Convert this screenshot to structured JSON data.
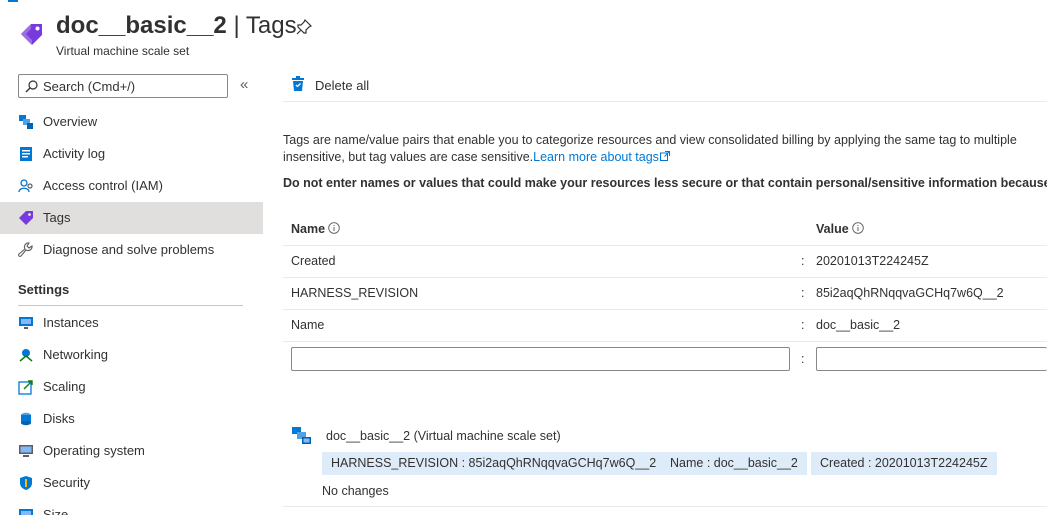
{
  "header": {
    "resource_name": "doc__basic__2",
    "separator": " | ",
    "blade_name": "Tags",
    "subtitle": "Virtual machine scale set",
    "icon": "tag-icon",
    "pin_icon": "pin-icon"
  },
  "sidebar": {
    "search_placeholder": "Search (Cmd+/)",
    "collapse_glyph": "«",
    "items": [
      {
        "label": "Overview",
        "icon": "overview-icon"
      },
      {
        "label": "Activity log",
        "icon": "activity-log-icon"
      },
      {
        "label": "Access control (IAM)",
        "icon": "iam-icon"
      },
      {
        "label": "Tags",
        "icon": "tag-icon",
        "active": true
      },
      {
        "label": "Diagnose and solve problems",
        "icon": "wrench-icon"
      }
    ],
    "settings_heading": "Settings",
    "settings_items": [
      {
        "label": "Instances",
        "icon": "instances-icon"
      },
      {
        "label": "Networking",
        "icon": "networking-icon"
      },
      {
        "label": "Scaling",
        "icon": "scaling-icon"
      },
      {
        "label": "Disks",
        "icon": "disks-icon"
      },
      {
        "label": "Operating system",
        "icon": "operating-system-icon"
      },
      {
        "label": "Security",
        "icon": "security-icon"
      },
      {
        "label": "Size",
        "icon": "size-icon"
      }
    ]
  },
  "toolbar": {
    "delete_all_label": "Delete all"
  },
  "main": {
    "description_line1": "Tags are name/value pairs that enable you to categorize resources and view consolidated billing by applying the same tag to multiple",
    "description_line2": "insensitive, but tag values are case sensitive.",
    "learn_more_link": "Learn more about tags",
    "warning": "Do not enter names or values that could make your resources less secure or that contain personal/sensitive information because t",
    "table": {
      "name_header": "Name",
      "value_header": "Value",
      "separator": ":",
      "rows": [
        {
          "name": "Created",
          "value": "20201013T224245Z"
        },
        {
          "name": "HARNESS_REVISION",
          "value": "85i2aqQhRNqqvaGCHq7w6Q__2"
        },
        {
          "name": "Name",
          "value": "doc__basic__2"
        }
      ],
      "new_name_value": "",
      "new_value_value": ""
    },
    "summary": {
      "resource_title": "doc__basic__2  (Virtual machine scale set)",
      "chips": [
        "HARNESS_REVISION : 85i2aqQhRNqqvaGCHq7w6Q__2",
        "Name : doc__basic__2",
        "Created : 20201013T224245Z"
      ],
      "status": "No changes"
    }
  },
  "colors": {
    "accent": "#0078d4",
    "active_nav_bg": "#e1dfdd",
    "chip_bg": "#deecf9",
    "tag_purple": "#773adc"
  }
}
